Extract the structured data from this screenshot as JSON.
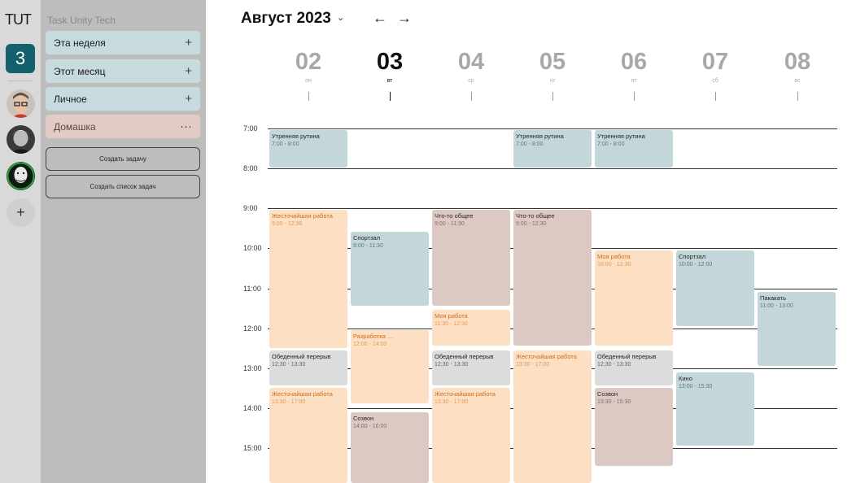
{
  "app": {
    "logo": "TUT",
    "org_name": "Task Unity Tech",
    "workspace_badge": "3"
  },
  "rail": {
    "avatars": [
      {
        "name": "avatar-user-1"
      },
      {
        "name": "avatar-user-2"
      },
      {
        "name": "avatar-user-3"
      }
    ],
    "add_label": "+"
  },
  "sidebar": {
    "lists": [
      {
        "label": "Эта неделя",
        "action": "+"
      },
      {
        "label": "Этот месяц",
        "action": "+"
      },
      {
        "label": "Личное",
        "action": "+"
      },
      {
        "label": "Домашка",
        "action": "···"
      }
    ],
    "create_task": "Создать задачу",
    "create_list": "Создать список задач"
  },
  "header": {
    "month": "Август 2023",
    "caret": "⌄",
    "prev": "←",
    "next": "→"
  },
  "days": [
    {
      "num": "02",
      "dow": "пн",
      "active": false
    },
    {
      "num": "03",
      "dow": "вт",
      "active": true
    },
    {
      "num": "04",
      "dow": "ср",
      "active": false
    },
    {
      "num": "05",
      "dow": "чт",
      "active": false
    },
    {
      "num": "06",
      "dow": "пт",
      "active": false
    },
    {
      "num": "07",
      "dow": "сб",
      "active": false
    },
    {
      "num": "08",
      "dow": "вс",
      "active": false
    }
  ],
  "hours": [
    "7:00",
    "8:00",
    "9:00",
    "10:00",
    "11:00",
    "12:00",
    "13:00",
    "14:00",
    "15:00"
  ],
  "events": [
    {
      "day": 0,
      "title": "Утренняя рутина",
      "time": "7:00 - 8:00",
      "start": 7.0,
      "end": 8.0,
      "color": "blue"
    },
    {
      "day": 0,
      "title": "Жесточайшая работа",
      "time": "9:00 - 12:30",
      "start": 9.0,
      "end": 12.5,
      "color": "orange"
    },
    {
      "day": 0,
      "title": "Обеденный перерыв",
      "time": "12:30 - 13:30",
      "start": 12.5,
      "end": 13.45,
      "color": "gray"
    },
    {
      "day": 0,
      "title": "Жесточайшая работа",
      "time": "13:30 - 17:00",
      "start": 13.45,
      "end": 17.0,
      "color": "orange"
    },
    {
      "day": 1,
      "title": "Спортзал",
      "time": "9:00 - 11:30",
      "start": 9.55,
      "end": 11.45,
      "color": "blue"
    },
    {
      "day": 1,
      "title": "Разработка ...",
      "time": "12:00 - 14:00",
      "start": 12.0,
      "end": 13.9,
      "color": "orange"
    },
    {
      "day": 1,
      "title": "Созвон",
      "time": "14:00 - 16:00",
      "start": 14.05,
      "end": 17.0,
      "color": "brown"
    },
    {
      "day": 2,
      "title": "Что-то общее",
      "time": "9:00 - 11:30",
      "start": 9.0,
      "end": 11.45,
      "color": "brown"
    },
    {
      "day": 2,
      "title": "Моя работа",
      "time": "11:30 - 12:30",
      "start": 11.5,
      "end": 12.45,
      "color": "orange"
    },
    {
      "day": 2,
      "title": "Обеденный перерыв",
      "time": "12:30 - 13:30",
      "start": 12.5,
      "end": 13.45,
      "color": "gray"
    },
    {
      "day": 2,
      "title": "Жесточайшая работа",
      "time": "13:30 - 17:00",
      "start": 13.45,
      "end": 17.0,
      "color": "orange"
    },
    {
      "day": 3,
      "title": "Утренняя рутина",
      "time": "7:00 - 8:00",
      "start": 7.0,
      "end": 8.0,
      "color": "blue"
    },
    {
      "day": 3,
      "title": "Что-то общее",
      "time": "9:00 - 12:30",
      "start": 9.0,
      "end": 12.45,
      "color": "brown"
    },
    {
      "day": 3,
      "title": "Жесточайшая работа",
      "time": "13:30 - 17:00",
      "start": 12.5,
      "end": 17.0,
      "color": "orange"
    },
    {
      "day": 4,
      "title": "Утренняя рутина",
      "time": "7:00 - 8:00",
      "start": 7.0,
      "end": 8.0,
      "color": "blue"
    },
    {
      "day": 4,
      "title": "Моя работа",
      "time": "10:00 - 12:30",
      "start": 10.0,
      "end": 12.45,
      "color": "orange"
    },
    {
      "day": 4,
      "title": "Обеденный перерыв",
      "time": "12:30 - 13:30",
      "start": 12.5,
      "end": 13.45,
      "color": "gray"
    },
    {
      "day": 4,
      "title": "Созвон",
      "time": "13:30 - 15:30",
      "start": 13.45,
      "end": 15.45,
      "color": "brown"
    },
    {
      "day": 5,
      "title": "Спортзал",
      "time": "10:00 - 12:00",
      "start": 10.0,
      "end": 11.95,
      "color": "blue"
    },
    {
      "day": 5,
      "title": "Кино",
      "time": "13:00 - 15:30",
      "start": 13.05,
      "end": 14.95,
      "color": "blue"
    },
    {
      "day": 6,
      "title": "Пакакать",
      "time": "11:00 - 13:00",
      "start": 11.05,
      "end": 12.95,
      "color": "blue"
    }
  ]
}
